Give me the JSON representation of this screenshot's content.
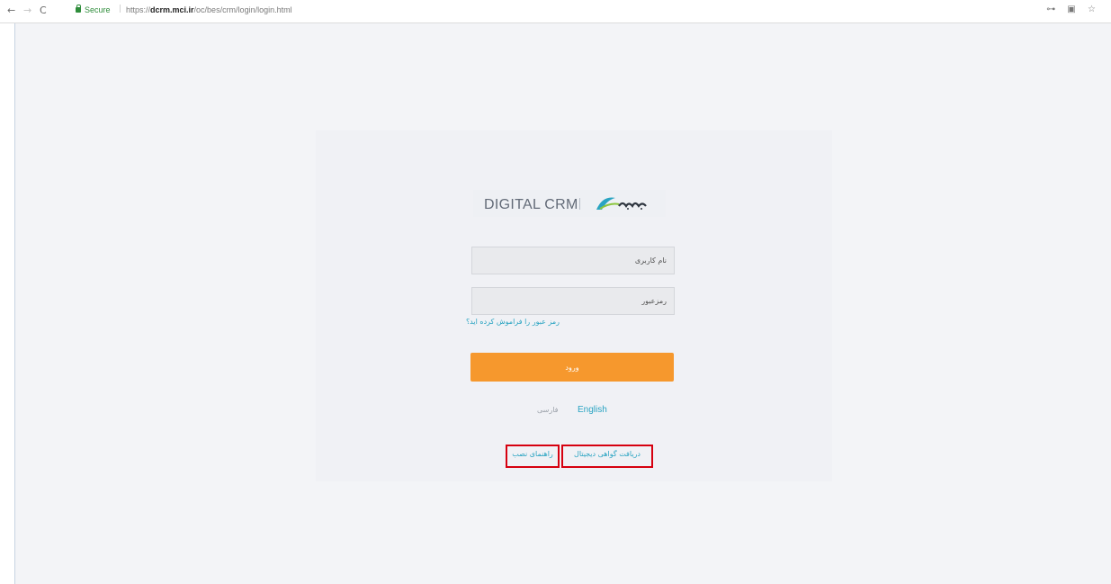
{
  "browser": {
    "back_icon": "←",
    "forward_icon": "→",
    "reload_icon": "C",
    "secure_label": "Secure",
    "url_scheme": "https://",
    "url_host": "dcrm.mci.ir",
    "url_path": "/oc/bes/crm/login/login.html",
    "right_icons": "⊶ ▣ ☆"
  },
  "login": {
    "logo_text": "DIGITAL CRM",
    "username_placeholder": "نام کاربری",
    "password_placeholder": "رمزعبور",
    "forgot_text": "رمز عبور را فراموش کرده اید؟",
    "submit_label": "ورود",
    "lang_farsi": "فارسی",
    "lang_english": "English",
    "guide_link": "راهنمای نصب",
    "certificate_link": "دریافت گواهی دیجیتال"
  },
  "colors": {
    "accent": "#f6982d",
    "link": "#2aa4c2",
    "highlight": "#d6000f"
  }
}
